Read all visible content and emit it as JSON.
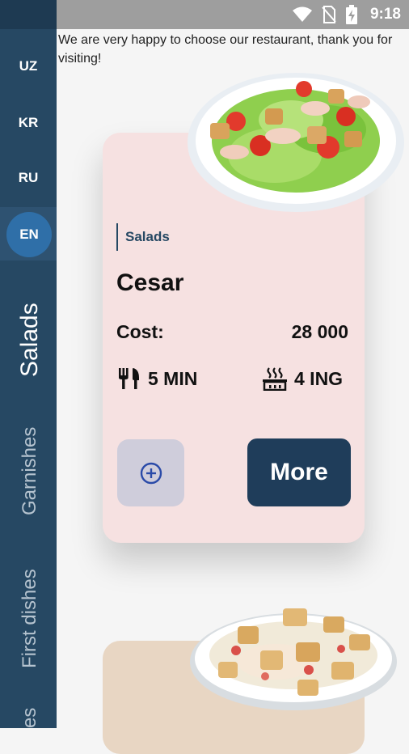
{
  "status_bar": {
    "time": "9:18",
    "icons": [
      "wifi-icon",
      "no-sim-icon",
      "battery-charging-icon"
    ]
  },
  "sidebar": {
    "languages": [
      {
        "code": "UZ",
        "active": false
      },
      {
        "code": "KR",
        "active": false
      },
      {
        "code": "RU",
        "active": false
      },
      {
        "code": "EN",
        "active": true
      }
    ],
    "categories": [
      {
        "label": "Salads",
        "active": true
      },
      {
        "label": "Garnishes",
        "active": false
      },
      {
        "label": "First dishes",
        "active": false
      },
      {
        "label": "es",
        "active": false
      }
    ]
  },
  "welcome_text": "We are very happy to choose our restaurant, thank you for visiting!",
  "cards": [
    {
      "category": "Salads",
      "name": "Cesar",
      "cost_label": "Cost:",
      "cost_value": "28 000",
      "time": "5 MIN",
      "time_icon": "fork-knife-icon",
      "ingredients": "4 ING",
      "ingredients_icon": "cooking-pot-icon",
      "add_icon": "plus-circle-icon",
      "more_label": "More",
      "image": "caesar-salad-plate-image",
      "background": "#f6e1e1"
    },
    {
      "image": "potato-salad-bowl-image",
      "background": "#e8d6c3"
    }
  ],
  "colors": {
    "sidebar": "#264863",
    "active_language": "#2f6fa8",
    "more_button": "#1f3d5a",
    "add_button": "#cfcddb",
    "status_bar": "#9e9e9e"
  }
}
